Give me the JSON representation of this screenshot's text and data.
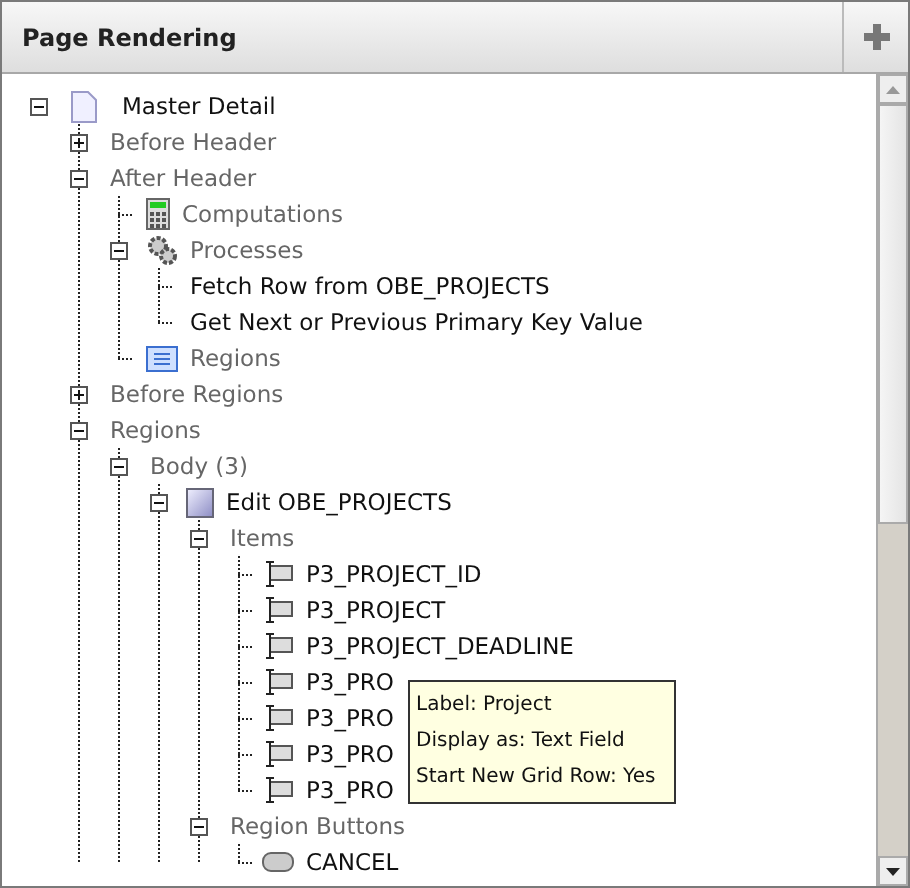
{
  "panel": {
    "title": "Page Rendering"
  },
  "tree": [
    {
      "label": "Master Detail",
      "kind": "page",
      "expanded": true,
      "children": [
        {
          "label": "Before Header",
          "kind": "group",
          "expanded": false
        },
        {
          "label": "After Header",
          "kind": "group",
          "expanded": true,
          "children": [
            {
              "label": "Computations",
              "kind": "computations"
            },
            {
              "label": "Processes",
              "kind": "processes",
              "expanded": true,
              "children": [
                {
                  "label": "Fetch Row from OBE_PROJECTS",
                  "kind": "process"
                },
                {
                  "label": "Get Next or Previous Primary Key Value",
                  "kind": "process"
                }
              ]
            },
            {
              "label": "Regions",
              "kind": "regions"
            }
          ]
        },
        {
          "label": "Before Regions",
          "kind": "group",
          "expanded": false
        },
        {
          "label": "Regions",
          "kind": "group",
          "expanded": true,
          "children": [
            {
              "label": "Body (3)",
              "kind": "group",
              "expanded": true,
              "children": [
                {
                  "label": "Edit OBE_PROJECTS",
                  "kind": "region",
                  "expanded": true,
                  "children": [
                    {
                      "label": "Items",
                      "kind": "group",
                      "expanded": true,
                      "children": [
                        {
                          "label": "P3_PROJECT_ID",
                          "kind": "item"
                        },
                        {
                          "label": "P3_PROJECT",
                          "kind": "item"
                        },
                        {
                          "label": "P3_PROJECT_DEADLINE",
                          "kind": "item"
                        },
                        {
                          "label": "P3_PRO",
                          "kind": "item"
                        },
                        {
                          "label": "P3_PRO",
                          "kind": "item"
                        },
                        {
                          "label": "P3_PRO",
                          "kind": "item"
                        },
                        {
                          "label": "P3_PRO",
                          "kind": "item"
                        }
                      ]
                    },
                    {
                      "label": "Region Buttons",
                      "kind": "group",
                      "expanded": true,
                      "children": [
                        {
                          "label": "CANCEL",
                          "kind": "button"
                        }
                      ]
                    }
                  ]
                }
              ]
            }
          ]
        }
      ]
    }
  ],
  "tooltip": {
    "lines": [
      "Label: Project",
      "Display as: Text Field",
      "Start New Grid Row: Yes"
    ]
  }
}
